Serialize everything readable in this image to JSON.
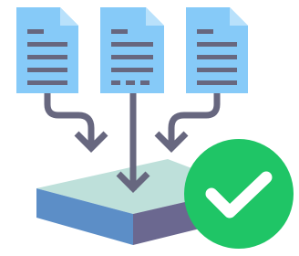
{
  "illustration": {
    "subject": "documents-merge-to-storage-success",
    "icons": [
      "document-icon",
      "document-icon",
      "document-icon",
      "arrow-down-icon",
      "storage-platform-icon",
      "check-circle-icon"
    ],
    "colors": {
      "document_fill": "#86CAF8",
      "document_fold": "#B9E1FB",
      "document_lines": "#67677F",
      "arrow": "#67677F",
      "platform_top": "#BEE0DA",
      "platform_front": "#5C8EC7",
      "platform_side": "#6B6890",
      "check_circle": "#1FC566",
      "check_mark": "#FFFFFF"
    }
  }
}
